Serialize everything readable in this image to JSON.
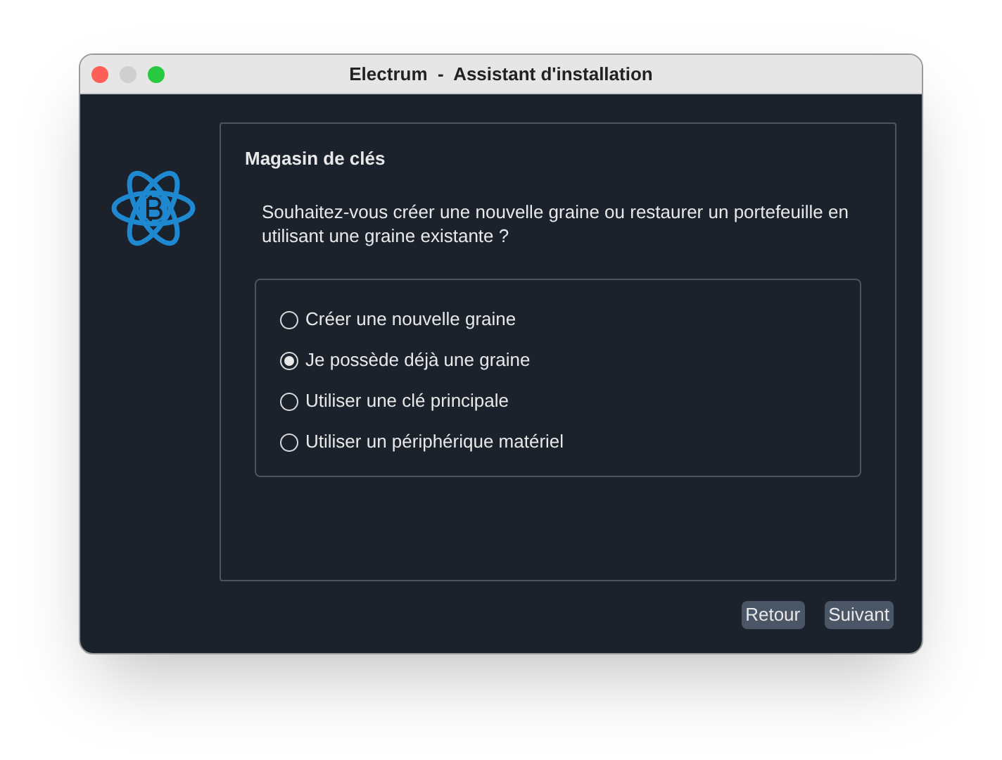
{
  "window": {
    "title": "Electrum  -  Assistant d'installation"
  },
  "panel": {
    "title": "Magasin de clés",
    "question": "Souhaitez-vous créer une nouvelle graine ou restaurer un portefeuille en utilisant une graine existante ?"
  },
  "options": [
    {
      "label": "Créer une nouvelle graine",
      "selected": false
    },
    {
      "label": "Je possède déjà une graine",
      "selected": true
    },
    {
      "label": "Utiliser une clé principale",
      "selected": false
    },
    {
      "label": "Utiliser un périphérique matériel",
      "selected": false
    }
  ],
  "buttons": [
    "Retour",
    "Suivant"
  ]
}
